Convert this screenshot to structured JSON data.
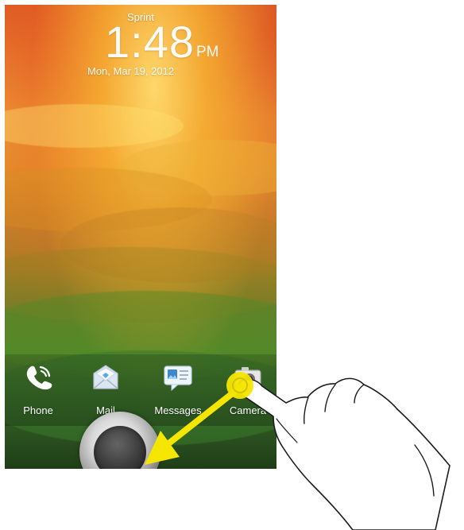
{
  "lockscreen": {
    "carrier": "Sprint",
    "time": "1:48",
    "ampm": "PM",
    "date": "Mon, Mar 19, 2012"
  },
  "apps": [
    {
      "label": "Phone",
      "icon": "phone-icon"
    },
    {
      "label": "Mail",
      "icon": "mail-icon"
    },
    {
      "label": "Messages",
      "icon": "messages-icon"
    },
    {
      "label": "Camera",
      "icon": "camera-icon"
    }
  ],
  "gesture": {
    "icons": [
      "hand-icon",
      "yellow-arrow-icon",
      "touch-circle-icon",
      "unlock-ring-icon"
    ]
  },
  "colors": {
    "accent": "#f4e600",
    "overlay_text": "#ffffff"
  }
}
